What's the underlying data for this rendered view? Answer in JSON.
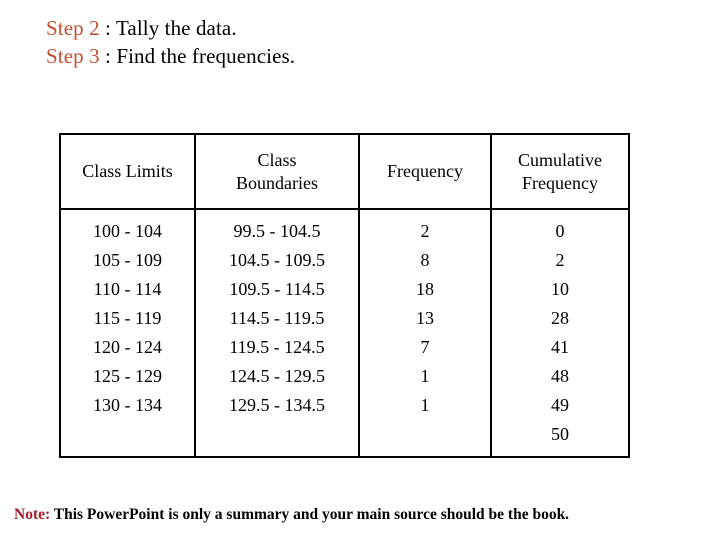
{
  "slide": {
    "title_lines": [
      {
        "step": "Step 2",
        "rest": " : Tally the data."
      },
      {
        "step": "Step 3",
        "rest": " : Find the frequencies."
      }
    ],
    "step_color": "#C0502F"
  },
  "table": {
    "headers": {
      "class_limits": "Class Limits",
      "class_boundaries_line1": "Class",
      "class_boundaries_line2": "Boundaries",
      "frequency": "Frequency",
      "cumulative_line1": "Cumulative",
      "cumulative_line2": "Frequency"
    },
    "columns": {
      "class_limits": [
        "100 - 104",
        "105 - 109",
        "110 - 114",
        "115 - 119",
        "120 - 124",
        "125 - 129",
        "130 - 134"
      ],
      "class_boundaries": [
        "99.5 - 104.5",
        "104.5 - 109.5",
        "109.5 - 114.5",
        "114.5 - 119.5",
        "119.5 - 124.5",
        "124.5 - 129.5",
        "129.5 - 134.5"
      ],
      "frequency": [
        "2",
        "8",
        "18",
        "13",
        "7",
        "1",
        "1"
      ],
      "cumulative_frequency": [
        "0",
        "2",
        "10",
        "28",
        "41",
        "48",
        "49",
        "50"
      ]
    }
  },
  "footer": {
    "note_label": "Note:",
    "note_text": " This PowerPoint is only a summary and your main source should be the book.",
    "note_label_color": "#A81D2D"
  }
}
